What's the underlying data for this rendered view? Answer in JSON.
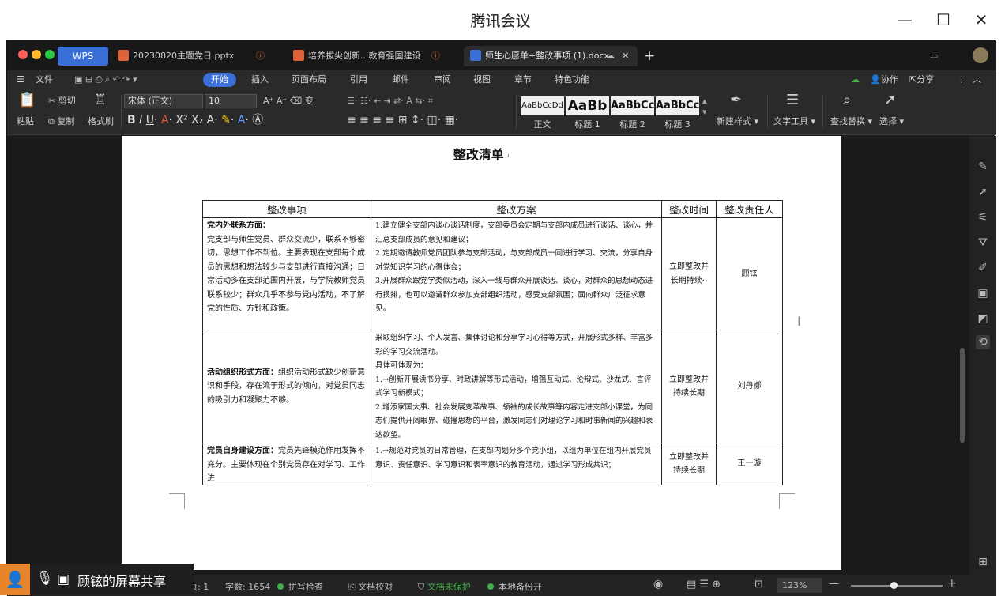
{
  "window": {
    "title": "腾讯会议"
  },
  "tabs": [
    {
      "label": "WPS"
    },
    {
      "label": "20230820主题党日.pptx"
    },
    {
      "label": "培养拔尖创新...教育强国建设"
    },
    {
      "label": "师生心愿单+整改事项 (1).docx"
    }
  ],
  "menu": {
    "file": "文件",
    "items": [
      "开始",
      "插入",
      "页面布局",
      "引用",
      "邮件",
      "审阅",
      "视图",
      "章节",
      "特色功能"
    ],
    "collab": "协作",
    "share": "分享"
  },
  "ribbon": {
    "paste": "粘贴",
    "cut": "剪切",
    "copy": "复制",
    "format_painter": "格式刷",
    "font": "宋体 (正文)",
    "size": "10",
    "styles": [
      {
        "preview": "AaBbCcDd",
        "label": "正文"
      },
      {
        "preview": "AaBb",
        "label": "标题 1"
      },
      {
        "preview": "AaBbCc",
        "label": "标题 2"
      },
      {
        "preview": "AaBbCc",
        "label": "标题 3"
      }
    ],
    "new_style": "新建样式",
    "text_tools": "文字工具",
    "find_replace": "查找替换",
    "select": "选择"
  },
  "document": {
    "title": "整改清单",
    "headers": [
      "整改事项",
      "整改方案",
      "整改时间",
      "整改责任人"
    ],
    "rows": [
      {
        "item_title": "党内外联系方面",
        "item_text": "党支部与师生党员、群众交流少，联系不够密切，思想工作不到位。主要表现在支部每个成员的思想和想法较少与支部进行直接沟通；日常活动多在支部范围内开展，与学院教师党员联系较少；群众几乎不参与党内活动，不了解党的性质、方针和政策。",
        "plan": [
          "1.建立健全支部内谈心谈话制度，支部委员会定期与支部内成员进行谈话、谈心，并汇总支部成员的意见和建议；",
          "2.定期邀请教师党员团队参与支部活动，与支部成员一同进行学习、交流，分享自身对党知识学习的心得体会；",
          "3.开展群众跟党学类似活动，深入一线与群众开展谈话、谈心，对群众的思想动态进行摸排，也可以邀请群众参加支部组织活动，感受支部氛围；面向群众广泛征求意见。"
        ],
        "time": "立即整改并长期持续··",
        "person": "顾铉"
      },
      {
        "item_title": "活动组织形式方面",
        "item_text": "组织活动形式缺少创新意识和手段，存在流于形式的倾向，对党员同志的吸引力和凝聚力不够。",
        "plan": [
          "采取组织学习、个人发言、集体讨论和分享学习心得等方式，开展形式多样、丰富多彩的学习交流活动。",
          "具体可体现为：",
          "1.→创新开展读书分享、时政讲解等形式活动，增强互动式、沦辩式、沙龙式、言评式学习新模式；",
          "2.增添家国大事、社会发展变革故事、领袖的成长故事等内容走进支部小课堂，为同志们提供开阔眼界、碰撞思想的平台，激发同志们对理论学习和时事新闻的兴趣和表达欲望。"
        ],
        "time": "立即整改并持续长期",
        "person": "刘丹娜"
      },
      {
        "item_title": "党员自身建设方面",
        "item_text": "党员先锋模范作用发挥不充分。主要体现在个别党员存在对学习、工作进",
        "plan": [
          "1.→规范对党员的日常管理，在支部内划分多个党小组，以组为单位在组内开展党员意识、责任意识、学习意识和表率意识的教育活动，通过学习形成共识；"
        ],
        "time": "立即整改并持续长期",
        "person": "王一璇"
      }
    ]
  },
  "status": {
    "page_frag": "页: 1",
    "words": "字数: 1654",
    "spell": "拼写检查",
    "proof": "文档校对",
    "protect": "文档未保护",
    "backup": "本地备份开",
    "zoom": "123%"
  },
  "screen_share": {
    "label": "顾铉的屏幕共享"
  }
}
